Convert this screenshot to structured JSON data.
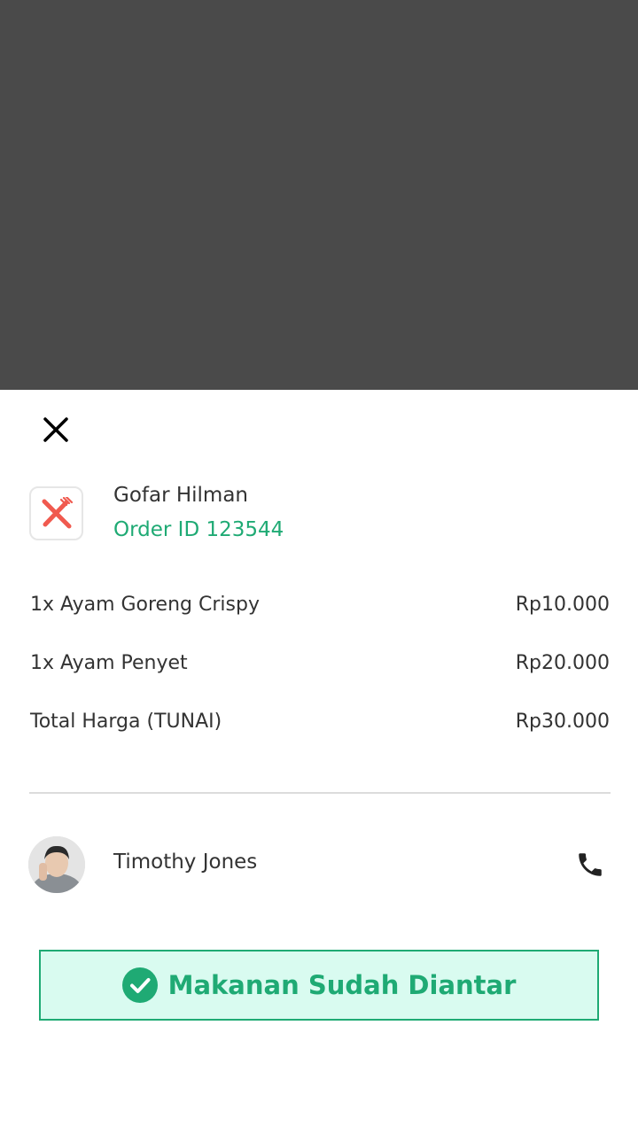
{
  "merchant": {
    "name": "Gofar Hilman",
    "order_id": "Order ID 123544",
    "icon": "utensils-icon"
  },
  "items": [
    {
      "label": "1x Ayam Goreng Crispy",
      "price": "Rp10.000"
    },
    {
      "label": "1x Ayam Penyet",
      "price": "Rp20.000"
    }
  ],
  "total": {
    "label": "Total Harga (TUNAI)",
    "price": "Rp30.000"
  },
  "courier": {
    "name": "Timothy Jones"
  },
  "action": {
    "label": "Makanan Sudah Diantar"
  },
  "colors": {
    "accent": "#1faa74",
    "accent_bg": "#d9fbf0",
    "icon_red": "#f05a4f",
    "overlay": "#4a4a4a"
  }
}
